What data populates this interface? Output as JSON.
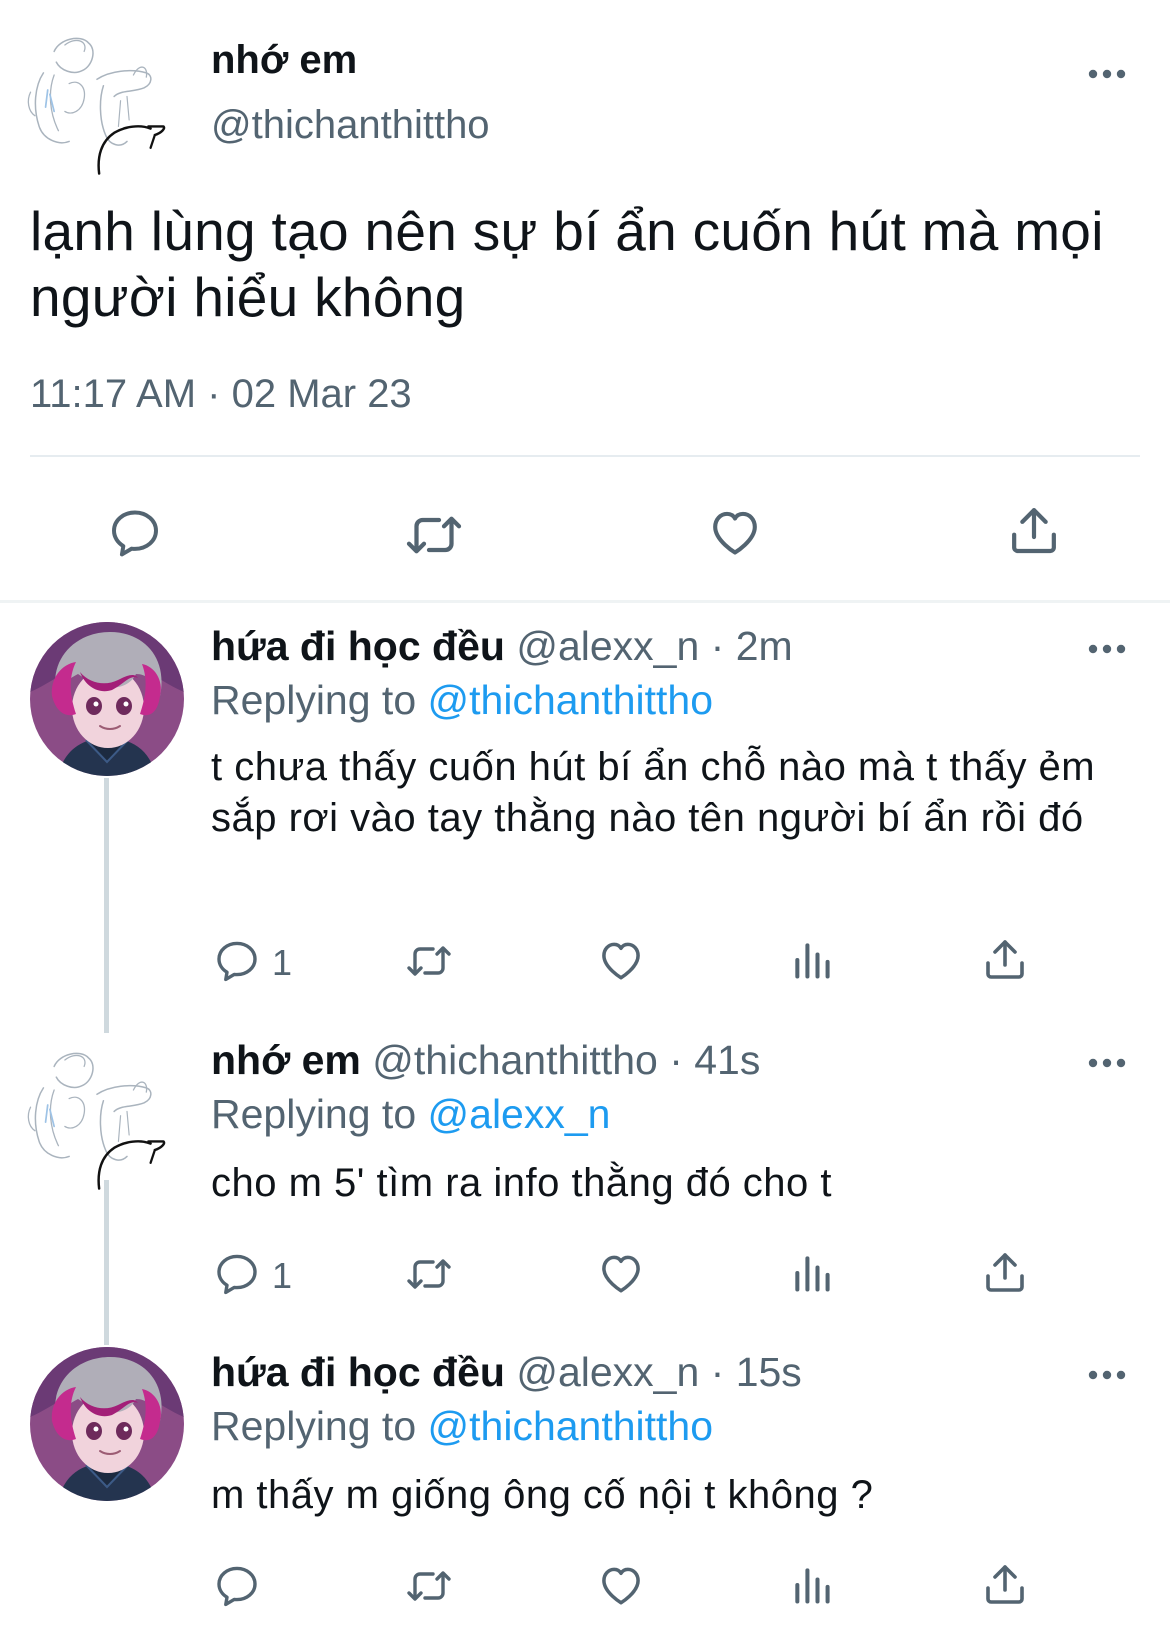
{
  "tweet": {
    "name": "nhớ em",
    "handle": "@thichanthittho",
    "text": "lạnh lùng tạo nên sự bí ẩn cuốn hút mà mọi người hiểu không",
    "timestamp": "11:17 AM · 02 Mar 23"
  },
  "replies": [
    {
      "name": "hứa đi học đều",
      "meta": " @alexx_n · 2m",
      "replying_prefix": "Replying to ",
      "replying_to": "@thichanthittho",
      "text": "t chưa thấy cuốn hút bí ẩn chỗ nào mà t thấy ẻm sắp rơi vào tay thằng nào tên người bí ẩn rồi đó",
      "reply_count": "1"
    },
    {
      "name": "nhớ em",
      "meta": " @thichanthittho · 41s",
      "replying_prefix": "Replying to ",
      "replying_to": "@alexx_n",
      "text": "cho m 5' tìm ra info thằng đó cho t",
      "reply_count": "1"
    },
    {
      "name": "hứa đi học đều",
      "meta": " @alexx_n · 15s",
      "replying_prefix": "Replying to ",
      "replying_to": "@thichanthittho",
      "text": "m thấy m giống ông cố nội t không ?",
      "reply_count": ""
    }
  ],
  "icons": [
    "more-icon",
    "reply-icon",
    "retweet-icon",
    "like-icon",
    "views-icon",
    "share-icon"
  ],
  "colors": {
    "text": "#0f1419",
    "secondary": "#536471",
    "link": "#1d9bf0",
    "divider": "#eff3f4"
  }
}
